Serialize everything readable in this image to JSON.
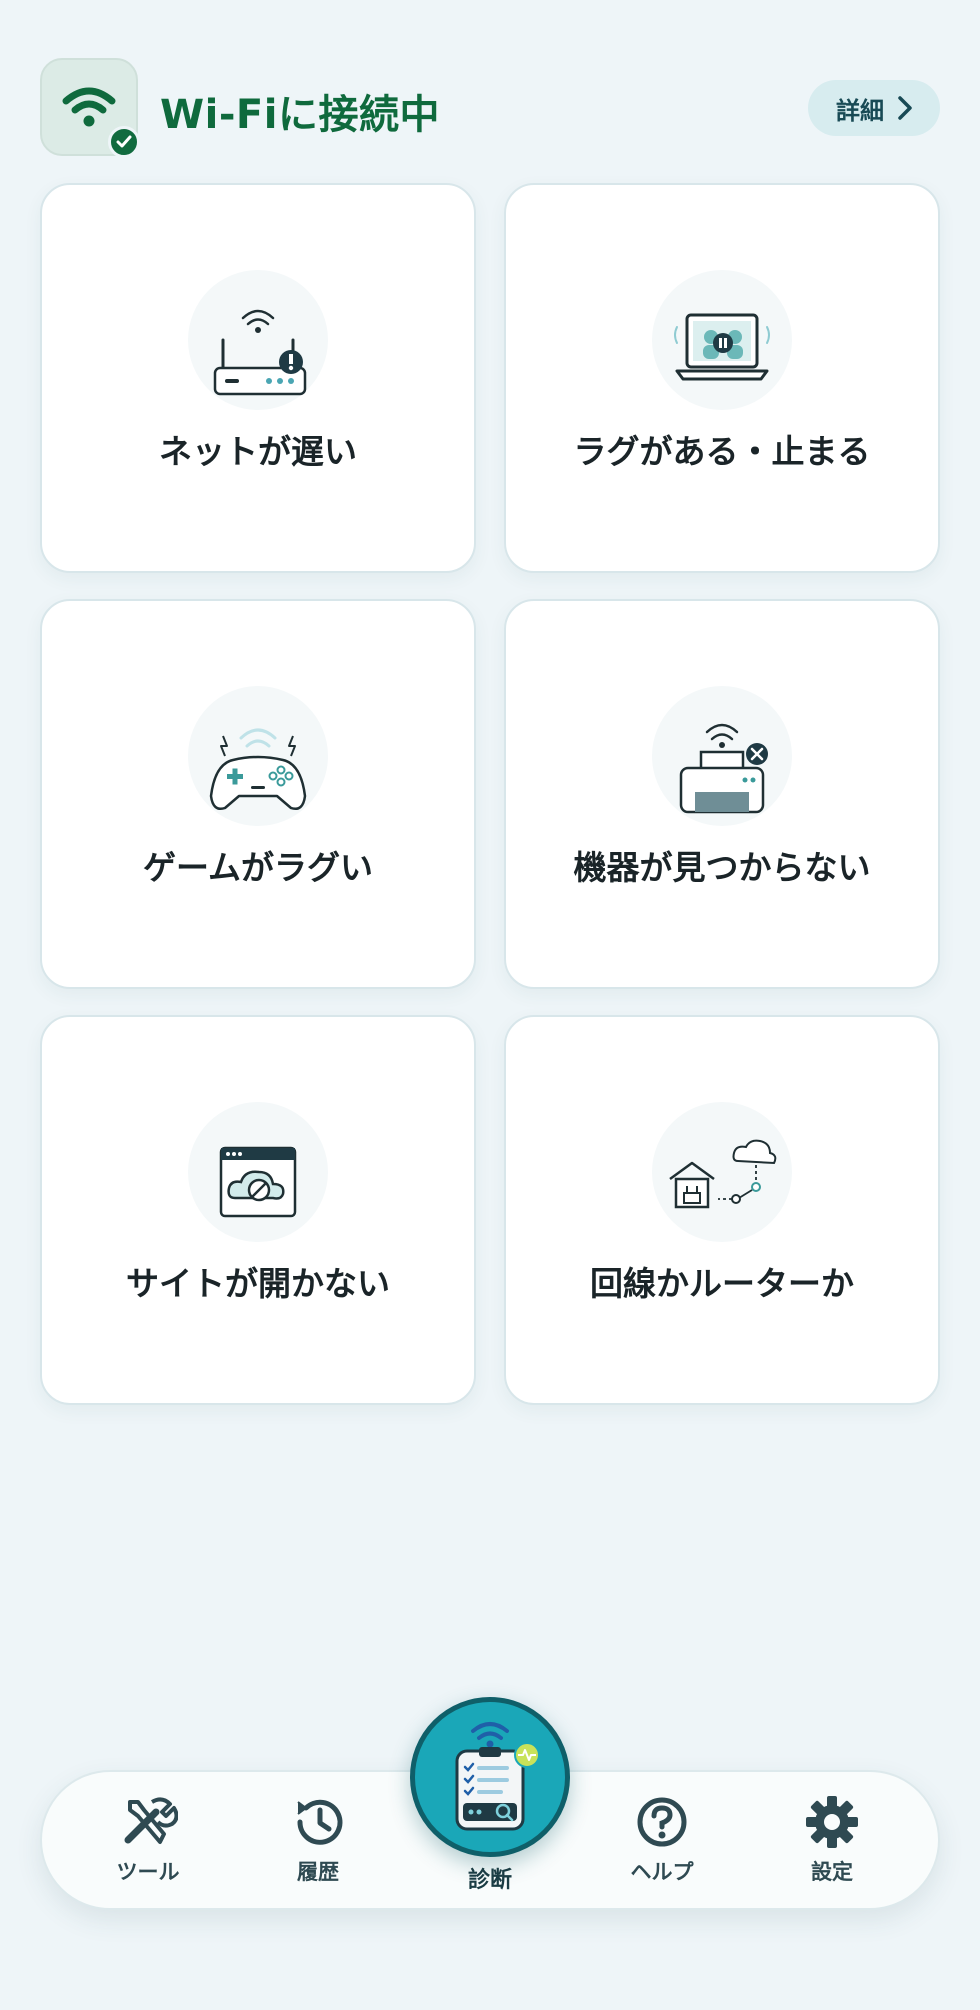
{
  "header": {
    "status_text": "Wi-Fiに接続中",
    "details_label": "詳細",
    "wifi_icon": "wifi-icon",
    "check_icon": "check-icon"
  },
  "cards": [
    {
      "label": "ネットが遅い",
      "icon": "router-warning-icon"
    },
    {
      "label": "ラグがある・止まる",
      "icon": "laptop-pause-icon"
    },
    {
      "label": "ゲームがラグい",
      "icon": "gamepad-icon"
    },
    {
      "label": "機器が見つからない",
      "icon": "printer-error-icon"
    },
    {
      "label": "サイトが開かない",
      "icon": "browser-blocked-icon"
    },
    {
      "label": "回線かルーターか",
      "icon": "home-router-cloud-icon"
    }
  ],
  "nav": {
    "tools_label": "ツール",
    "history_label": "履歴",
    "diagnose_label": "診断",
    "help_label": "ヘルプ",
    "settings_label": "設定"
  },
  "colors": {
    "accent_green": "#0f6a3d",
    "accent_teal": "#1aa7b8",
    "background": "#eef5f8"
  }
}
